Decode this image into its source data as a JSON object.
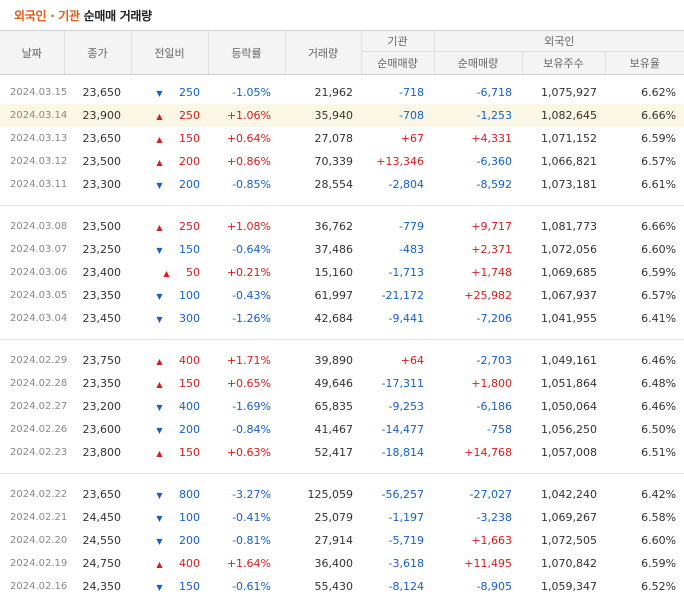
{
  "title": {
    "highlight": "외국인 · 기관",
    "rest": " 순매매 거래량"
  },
  "headers": {
    "date": "날짜",
    "close": "종가",
    "change": "전일비",
    "rate": "등락률",
    "volume": "거래량",
    "inst": "기관",
    "foreign": "외국인",
    "inst_net": "순매매량",
    "foreign_net": "순매매량",
    "foreign_shares": "보유주수",
    "foreign_ratio": "보유율"
  },
  "groups": [
    [
      {
        "date": "2024.03.15",
        "close": "23,650",
        "dir": "down",
        "change": "250",
        "rate": "-1.05%",
        "volume": "21,962",
        "inst": "-718",
        "foreign": "-6,718",
        "shares": "1,075,927",
        "ratio": "6.62%"
      },
      {
        "date": "2024.03.14",
        "close": "23,900",
        "dir": "up",
        "change": "250",
        "rate": "+1.06%",
        "volume": "35,940",
        "inst": "-708",
        "foreign": "-1,253",
        "shares": "1,082,645",
        "ratio": "6.66%",
        "highlight": true
      },
      {
        "date": "2024.03.13",
        "close": "23,650",
        "dir": "up",
        "change": "150",
        "rate": "+0.64%",
        "volume": "27,078",
        "inst": "+67",
        "foreign": "+4,331",
        "shares": "1,071,152",
        "ratio": "6.59%"
      },
      {
        "date": "2024.03.12",
        "close": "23,500",
        "dir": "up",
        "change": "200",
        "rate": "+0.86%",
        "volume": "70,339",
        "inst": "+13,346",
        "foreign": "-6,360",
        "shares": "1,066,821",
        "ratio": "6.57%"
      },
      {
        "date": "2024.03.11",
        "close": "23,300",
        "dir": "down",
        "change": "200",
        "rate": "-0.85%",
        "volume": "28,554",
        "inst": "-2,804",
        "foreign": "-8,592",
        "shares": "1,073,181",
        "ratio": "6.61%"
      }
    ],
    [
      {
        "date": "2024.03.08",
        "close": "23,500",
        "dir": "up",
        "change": "250",
        "rate": "+1.08%",
        "volume": "36,762",
        "inst": "-779",
        "foreign": "+9,717",
        "shares": "1,081,773",
        "ratio": "6.66%"
      },
      {
        "date": "2024.03.07",
        "close": "23,250",
        "dir": "down",
        "change": "150",
        "rate": "-0.64%",
        "volume": "37,486",
        "inst": "-483",
        "foreign": "+2,371",
        "shares": "1,072,056",
        "ratio": "6.60%"
      },
      {
        "date": "2024.03.06",
        "close": "23,400",
        "dir": "up",
        "change": "50",
        "rate": "+0.21%",
        "volume": "15,160",
        "inst": "-1,713",
        "foreign": "+1,748",
        "shares": "1,069,685",
        "ratio": "6.59%"
      },
      {
        "date": "2024.03.05",
        "close": "23,350",
        "dir": "down",
        "change": "100",
        "rate": "-0.43%",
        "volume": "61,997",
        "inst": "-21,172",
        "foreign": "+25,982",
        "shares": "1,067,937",
        "ratio": "6.57%"
      },
      {
        "date": "2024.03.04",
        "close": "23,450",
        "dir": "down",
        "change": "300",
        "rate": "-1.26%",
        "volume": "42,684",
        "inst": "-9,441",
        "foreign": "-7,206",
        "shares": "1,041,955",
        "ratio": "6.41%"
      }
    ],
    [
      {
        "date": "2024.02.29",
        "close": "23,750",
        "dir": "up",
        "change": "400",
        "rate": "+1.71%",
        "volume": "39,890",
        "inst": "+64",
        "foreign": "-2,703",
        "shares": "1,049,161",
        "ratio": "6.46%"
      },
      {
        "date": "2024.02.28",
        "close": "23,350",
        "dir": "up",
        "change": "150",
        "rate": "+0.65%",
        "volume": "49,646",
        "inst": "-17,311",
        "foreign": "+1,800",
        "shares": "1,051,864",
        "ratio": "6.48%"
      },
      {
        "date": "2024.02.27",
        "close": "23,200",
        "dir": "down",
        "change": "400",
        "rate": "-1.69%",
        "volume": "65,835",
        "inst": "-9,253",
        "foreign": "-6,186",
        "shares": "1,050,064",
        "ratio": "6.46%"
      },
      {
        "date": "2024.02.26",
        "close": "23,600",
        "dir": "down",
        "change": "200",
        "rate": "-0.84%",
        "volume": "41,467",
        "inst": "-14,477",
        "foreign": "-758",
        "shares": "1,056,250",
        "ratio": "6.50%"
      },
      {
        "date": "2024.02.23",
        "close": "23,800",
        "dir": "up",
        "change": "150",
        "rate": "+0.63%",
        "volume": "52,417",
        "inst": "-18,814",
        "foreign": "+14,768",
        "shares": "1,057,008",
        "ratio": "6.51%"
      }
    ],
    [
      {
        "date": "2024.02.22",
        "close": "23,650",
        "dir": "down",
        "change": "800",
        "rate": "-3.27%",
        "volume": "125,059",
        "inst": "-56,257",
        "foreign": "-27,027",
        "shares": "1,042,240",
        "ratio": "6.42%"
      },
      {
        "date": "2024.02.21",
        "close": "24,450",
        "dir": "down",
        "change": "100",
        "rate": "-0.41%",
        "volume": "25,079",
        "inst": "-1,197",
        "foreign": "-3,238",
        "shares": "1,069,267",
        "ratio": "6.58%"
      },
      {
        "date": "2024.02.20",
        "close": "24,550",
        "dir": "down",
        "change": "200",
        "rate": "-0.81%",
        "volume": "27,914",
        "inst": "-5,719",
        "foreign": "+1,663",
        "shares": "1,072,505",
        "ratio": "6.60%"
      },
      {
        "date": "2024.02.19",
        "close": "24,750",
        "dir": "up",
        "change": "400",
        "rate": "+1.64%",
        "volume": "36,400",
        "inst": "-3,618",
        "foreign": "+11,495",
        "shares": "1,070,842",
        "ratio": "6.59%"
      },
      {
        "date": "2024.02.16",
        "close": "24,350",
        "dir": "down",
        "change": "150",
        "rate": "-0.61%",
        "volume": "55,430",
        "inst": "-8,124",
        "foreign": "-8,905",
        "shares": "1,059,347",
        "ratio": "6.52%"
      }
    ]
  ],
  "colors": {
    "accent": "#e85a1a",
    "up": "#d81c1c",
    "down": "#1560c8",
    "highlight_row": "#faf8e5"
  }
}
